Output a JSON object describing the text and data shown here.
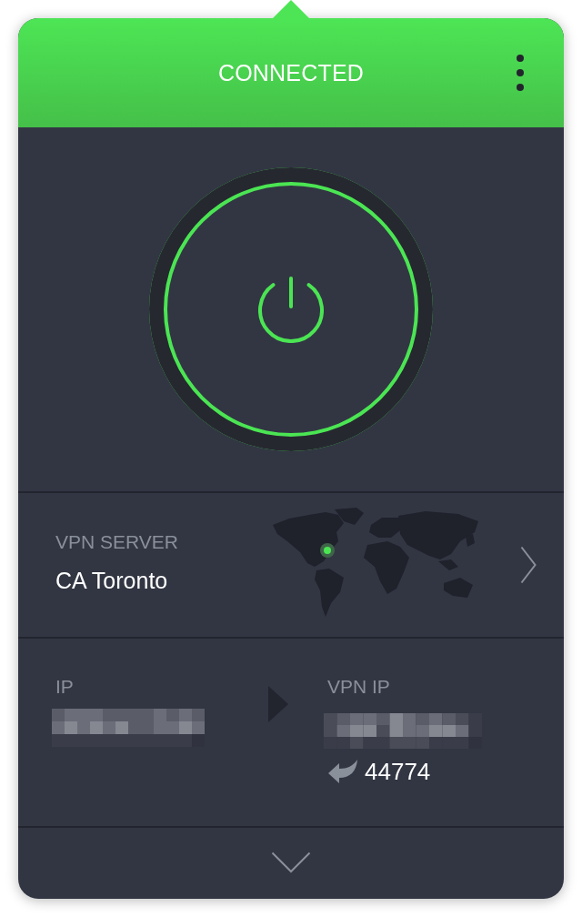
{
  "header": {
    "status": "CONNECTED",
    "connected": true
  },
  "server": {
    "label": "VPN SERVER",
    "name": "CA Toronto"
  },
  "ip": {
    "label": "IP"
  },
  "vpn_ip": {
    "label": "VPN IP",
    "port": "44774"
  }
}
